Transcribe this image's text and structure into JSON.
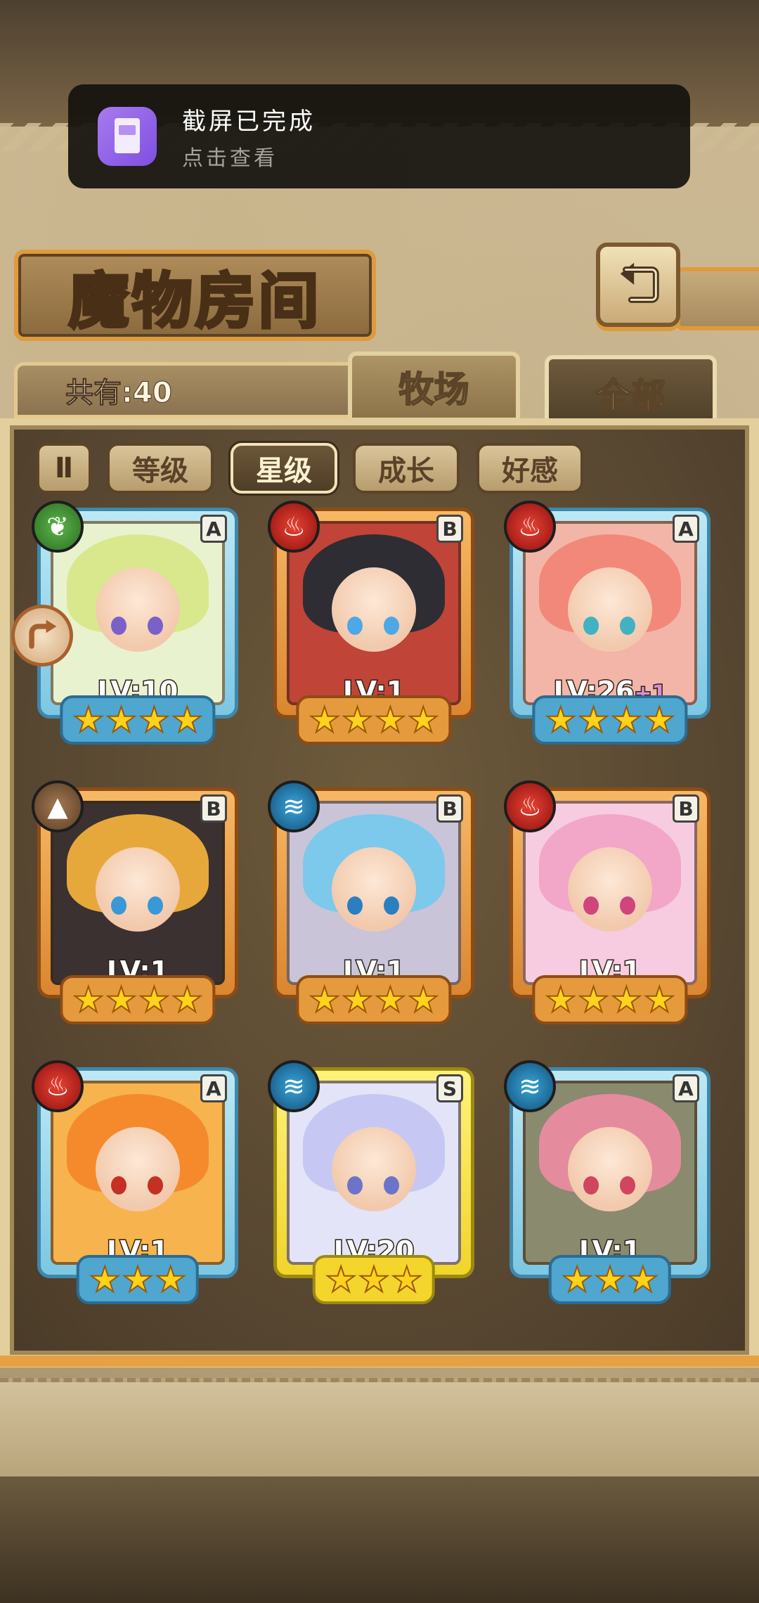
{
  "toast": {
    "title": "截屏已完成",
    "subtitle": "点击查看"
  },
  "header": {
    "title": "魔物房间"
  },
  "tabs": {
    "count_label": "共有:40",
    "ranch": "牧场",
    "all": "全部"
  },
  "filters": {
    "sort_toggle": "Ⅱ",
    "level": "等级",
    "star": "星级",
    "growth": "成长",
    "affection": "好感",
    "active": "星级"
  },
  "monsters": [
    {
      "element": "leaf-icon",
      "rank": "A",
      "level": "LV:10",
      "bonus": "",
      "stars": 4,
      "hair": "#d9e88c",
      "eyes": "#7b60c9",
      "bg": "#e9f2cf"
    },
    {
      "element": "fire-icon",
      "rank": "B",
      "level": "LV:1",
      "bonus": "",
      "stars": 4,
      "hair": "#2d2d33",
      "eyes": "#4ea7e6",
      "bg": "#c04438"
    },
    {
      "element": "fire-icon",
      "rank": "A",
      "level": "LV:26",
      "bonus": "+1",
      "stars": 4,
      "hair": "#f2887a",
      "eyes": "#42b1c4",
      "bg": "#f3b5a7"
    },
    {
      "element": "earth-icon",
      "rank": "B",
      "level": "LV:1",
      "bonus": "",
      "stars": 4,
      "hair": "#e7a83b",
      "eyes": "#3a98d6",
      "bg": "#3a3130"
    },
    {
      "element": "water-icon",
      "rank": "B",
      "level": "LV:1",
      "bonus": "",
      "stars": 4,
      "hair": "#7cc9ec",
      "eyes": "#2a7fc0",
      "bg": "#c9c4d7"
    },
    {
      "element": "fire-icon",
      "rank": "B",
      "level": "LV:1",
      "bonus": "",
      "stars": 4,
      "hair": "#f2a6c8",
      "eyes": "#d0457e",
      "bg": "#f7cbe0"
    },
    {
      "element": "fire-icon",
      "rank": "A",
      "level": "LV:1",
      "bonus": "",
      "stars": 3,
      "hair": "#f58a2c",
      "eyes": "#c43024",
      "bg": "#f7b34e"
    },
    {
      "element": "water-icon",
      "rank": "S",
      "level": "LV:20",
      "bonus": "",
      "stars": 3,
      "hair": "#c6c8f3",
      "eyes": "#6b74c9",
      "bg": "#e3e4f7"
    },
    {
      "element": "water-icon",
      "rank": "A",
      "level": "LV:1",
      "bonus": "",
      "stars": 3,
      "hair": "#e58b9e",
      "eyes": "#d0465e",
      "bg": "#8a8a6e"
    }
  ]
}
